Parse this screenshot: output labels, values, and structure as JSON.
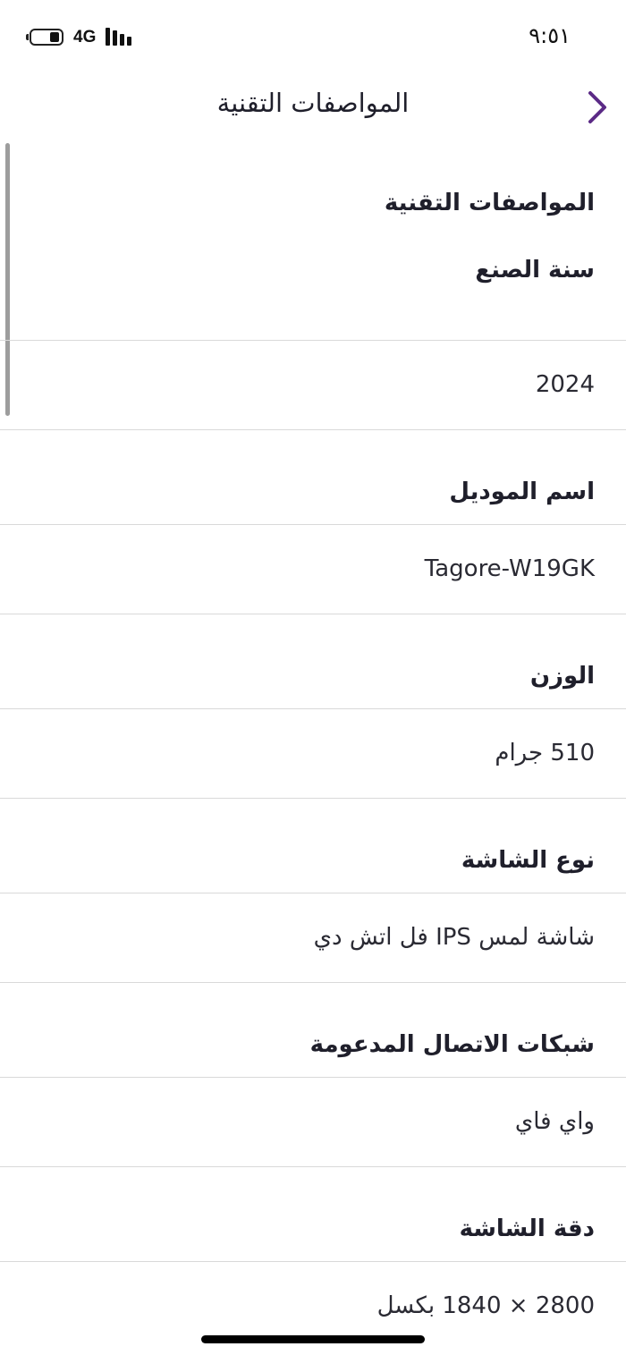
{
  "status_bar": {
    "network": "4G",
    "time": "٩:٥١"
  },
  "header": {
    "title": "المواصفات التقنية",
    "back_icon": "chevron-left-icon",
    "accent_color": "#5b2a86"
  },
  "section": {
    "heading": "المواصفات التقنية"
  },
  "specs": [
    {
      "label": "سنة الصنع",
      "value": "2024"
    },
    {
      "label": "اسم الموديل",
      "value": "Tagore-W19GK"
    },
    {
      "label": "الوزن",
      "value": "510 جرام"
    },
    {
      "label": "نوع الشاشة",
      "value": "شاشة لمس IPS فل اتش دي"
    },
    {
      "label": "شبكات الاتصال المدعومة",
      "value": "واي فاي"
    },
    {
      "label": "دقة الشاشة",
      "value": "2800 × 1840 بكسل"
    }
  ]
}
